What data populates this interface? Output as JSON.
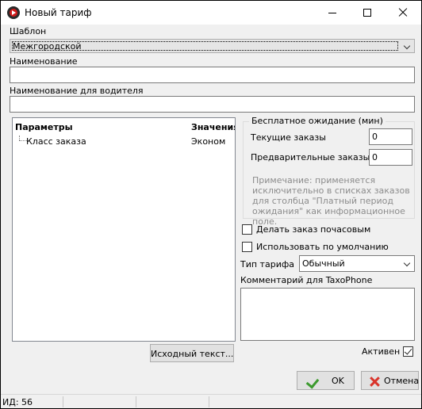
{
  "window": {
    "title": "Новый тариф"
  },
  "template": {
    "label": "Шаблон",
    "selected": "Межгородской"
  },
  "name": {
    "label": "Наименование",
    "value": ""
  },
  "driver_name": {
    "label": "Наименование для водителя",
    "value": ""
  },
  "params_tree": {
    "col_params": "Параметры",
    "col_values": "Значения",
    "rows": [
      {
        "param": "Класс заказа",
        "value": "Эконом"
      }
    ]
  },
  "free_wait": {
    "title": "Бесплатное ожидание (мин)",
    "current_label": "Текущие заказы",
    "current_value": "0",
    "preorder_label": "Предварительные заказы",
    "preorder_value": "0",
    "note": "Примечание: применяется исключительно в списках заказов для столбца \"Платный период ожидания\" как информационное поле."
  },
  "hourly": {
    "label": "Делать заказ почасовым",
    "checked": false
  },
  "default": {
    "label": "Использовать по умолчанию",
    "checked": false
  },
  "tariff_type": {
    "label": "Тип тарифа",
    "selected": "Обычный"
  },
  "taxophone_comment": {
    "label": "Комментарий для TaxoPhone",
    "value": ""
  },
  "source_button": {
    "label": "Исходный текст..."
  },
  "active": {
    "label": "Активен",
    "checked": true
  },
  "buttons": {
    "ok": "OK",
    "cancel": "Отмена"
  },
  "status": {
    "id_text": "ИД: 56"
  },
  "icons": {
    "app": "taxi-app-icon",
    "ok": "checkmark-icon",
    "cancel": "cross-icon"
  },
  "colors": {
    "ok_icon": "#3c9a2e",
    "cancel_icon": "#d9342b"
  }
}
